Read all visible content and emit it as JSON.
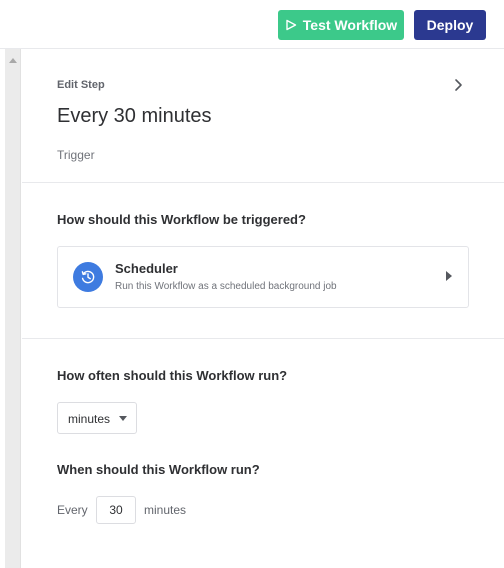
{
  "toolbar": {
    "test_label": "Test Workflow",
    "test_icon": "play-icon",
    "deploy_label": "Deploy",
    "test_color": "#3cc98a",
    "deploy_color": "#2b3990"
  },
  "step": {
    "eyebrow": "Edit Step",
    "title": "Every 30 minutes",
    "type": "Trigger"
  },
  "trigger": {
    "question": "How should this Workflow be triggered?",
    "card": {
      "icon": "clock-refresh-icon",
      "icon_color": "#3e7be0",
      "title": "Scheduler",
      "description": "Run this Workflow as a scheduled background job"
    }
  },
  "schedule": {
    "frequency_question": "How often should this Workflow run?",
    "frequency_value": "minutes",
    "timing_question": "When should this Workflow run?",
    "every_label": "Every",
    "interval_value": "30",
    "unit_label": "minutes"
  }
}
